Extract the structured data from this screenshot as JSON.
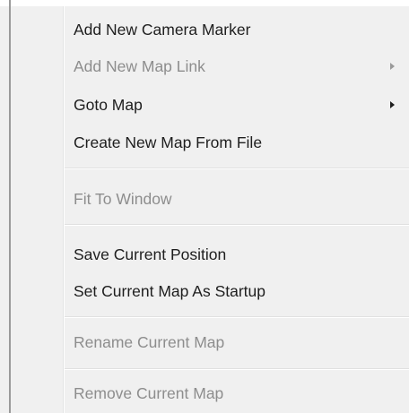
{
  "menu": {
    "items": [
      {
        "label": "Add New Camera Marker",
        "enabled": true,
        "submenu": false
      },
      {
        "label": "Add New Map Link",
        "enabled": false,
        "submenu": true
      },
      {
        "label": "Goto Map",
        "enabled": true,
        "submenu": true
      },
      {
        "label": "Create New Map From File",
        "enabled": true,
        "submenu": false
      },
      {
        "label": "Fit To Window",
        "enabled": false,
        "submenu": false
      },
      {
        "label": "Save Current Position",
        "enabled": true,
        "submenu": false
      },
      {
        "label": "Set Current Map As Startup",
        "enabled": true,
        "submenu": false
      },
      {
        "label": "Rename Current Map",
        "enabled": false,
        "submenu": false
      },
      {
        "label": "Remove Current Map",
        "enabled": false,
        "submenu": false
      }
    ]
  },
  "colors": {
    "text_enabled": "#1e1e1e",
    "text_disabled": "#8d8d8d",
    "menu_background": "#f0f0f0"
  },
  "icons": {
    "submenu_arrow": "chevron-right-icon"
  }
}
